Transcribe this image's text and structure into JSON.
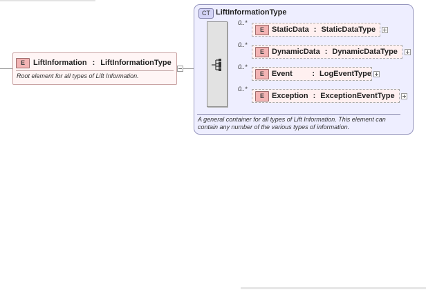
{
  "root_element": {
    "badge": "E",
    "name": "LiftInformation",
    "type": "LiftInformationType",
    "description": "Root element for all types of Lift Information."
  },
  "complex_type": {
    "badge": "CT",
    "name": "LiftInformationType",
    "description": "A general container for all types of Lift Information. This element can contain any number of the various types of information.",
    "children": [
      {
        "badge": "E",
        "multiplicity": "0..*",
        "name": "StaticData",
        "type": "StaticDataType"
      },
      {
        "badge": "E",
        "multiplicity": "0..*",
        "name": "DynamicData",
        "type": "DynamicDataType"
      },
      {
        "badge": "E",
        "multiplicity": "0..*",
        "name": "Event",
        "type": "LogEventType"
      },
      {
        "badge": "E",
        "multiplicity": "0..*",
        "name": "Exception",
        "type": "ExceptionEventType"
      }
    ]
  },
  "icons": {
    "sequence": "sequence-compositor-icon",
    "expand": "plus-toggle-icon",
    "collapse": "minus-toggle-icon"
  },
  "colors": {
    "element_fill": "#fff0f0",
    "element_badge": "#f3b4b4",
    "complex_type_fill": "#eeeeff",
    "complex_type_border": "#9797bf"
  }
}
